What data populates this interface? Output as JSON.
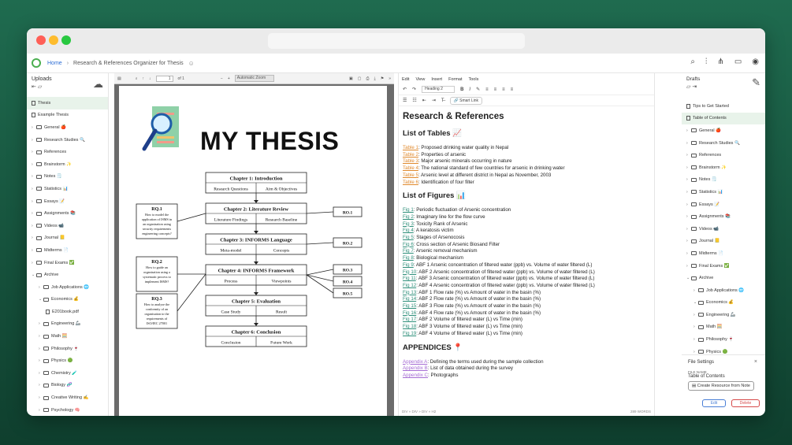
{
  "breadcrumb": {
    "home": "Home",
    "current": "Research & References Organizer for Thesis"
  },
  "left_panel": {
    "title": "Uploads",
    "items": [
      {
        "label": "Thesis",
        "type": "doc",
        "selected": true,
        "indent": 0
      },
      {
        "label": "Example Thesis",
        "type": "doc",
        "indent": 0
      },
      {
        "label": "General 🍎",
        "type": "folder",
        "indent": 0
      },
      {
        "label": "Research Studies 🔍",
        "type": "folder",
        "indent": 0
      },
      {
        "label": "References",
        "type": "folder",
        "indent": 0
      },
      {
        "label": "Brainstorm ✨",
        "type": "folder",
        "indent": 0
      },
      {
        "label": "Notes 🗒️",
        "type": "folder",
        "indent": 0
      },
      {
        "label": "Statistics 📊",
        "type": "folder",
        "indent": 0
      },
      {
        "label": "Essays 📝",
        "type": "folder",
        "indent": 0
      },
      {
        "label": "Assignments 📚",
        "type": "folder",
        "indent": 0
      },
      {
        "label": "Videos 📹",
        "type": "folder",
        "indent": 0
      },
      {
        "label": "Journal 📒",
        "type": "folder",
        "indent": 0
      },
      {
        "label": "Midterms 📄",
        "type": "folder",
        "indent": 0
      },
      {
        "label": "Final Exams ✅",
        "type": "folder",
        "indent": 0
      },
      {
        "label": "Archive",
        "type": "folder",
        "indent": 0
      },
      {
        "label": "Job Applications 🌐",
        "type": "folder",
        "indent": 1
      },
      {
        "label": "Economics 💰",
        "type": "folder",
        "indent": 1
      },
      {
        "label": "E201book.pdf",
        "type": "doc",
        "indent": 2
      },
      {
        "label": "Engineering 🦾",
        "type": "folder",
        "indent": 1
      },
      {
        "label": "Math 🧮",
        "type": "folder",
        "indent": 1
      },
      {
        "label": "Philosophy 🍷",
        "type": "folder",
        "indent": 1
      },
      {
        "label": "Physics 🟢",
        "type": "folder",
        "indent": 1
      },
      {
        "label": "Chemistry 🧪",
        "type": "folder",
        "indent": 1
      },
      {
        "label": "Biology 🧬",
        "type": "folder",
        "indent": 1
      },
      {
        "label": "Creative Writing ✍️",
        "type": "folder",
        "indent": 1
      },
      {
        "label": "Psychology 🧠",
        "type": "folder",
        "indent": 1
      }
    ]
  },
  "pdf": {
    "page_number": "1",
    "page_of": "of 1",
    "zoom": "Automatic Zoom",
    "title": "MY THESIS",
    "chapters": [
      {
        "title": "Chapter 1: Introduction",
        "left": "Research Questions",
        "right": "Aim & Objectives"
      },
      {
        "title": "Chapter 2: Literature Review",
        "left": "Literature Findings",
        "right": "Research Baseline"
      },
      {
        "title": "Chapter 3: INFORMS Language",
        "left": "Meta-model",
        "right": "Concepts"
      },
      {
        "title": "Chapter 4: INFORMS Framework",
        "left": "Process",
        "right": "Viewpoints"
      },
      {
        "title": "Chapter 5: Evaluation",
        "left": "Case Study",
        "right": "Result"
      },
      {
        "title": "Chapter 6: Conclusion",
        "left": "Conclusion",
        "right": "Future Work"
      }
    ],
    "rq": [
      {
        "title": "RQ.1",
        "text": "How to model the application of ISMS in an organisation using security requirements engineering concepts?"
      },
      {
        "title": "RQ.2",
        "text": "How to guide an organisation using a systematic process to implement ISMS?"
      },
      {
        "title": "RQ.3",
        "text": "How to analyse the conformity of an organisation to the requirements of ISO/IEC 27001 Standard?"
      }
    ],
    "ro": [
      "RO.1",
      "RO.2",
      "RO.3",
      "RO.4",
      "RO.5"
    ]
  },
  "editor": {
    "menu": [
      "Edit",
      "View",
      "Insert",
      "Format",
      "Tools"
    ],
    "heading_select": "Heading 2",
    "smart_link": "Smart Link",
    "doc_title": "Research & References",
    "tables_heading": "List of Tables 📈",
    "tables": [
      {
        "link": "Table 1",
        "text": ": Proposed drinking water quality in Nepal"
      },
      {
        "link": "Table 2",
        "text": ": Properties of arsenic"
      },
      {
        "link": "Table 3",
        "text": ": Major arsenic minerals occurring in nature"
      },
      {
        "link": "Table 4",
        "text": ": The national standard of few countries for arsenic in drinking water"
      },
      {
        "link": "Table 5",
        "text": ": Arsenic level at different district in Nepal as November, 2003"
      },
      {
        "link": "Table 6",
        "text": ": Identification of four filter"
      }
    ],
    "figures_heading": "List of Figures 📊",
    "figures": [
      {
        "link": "Fig 1",
        "text": ": Periodic fluctuation of Arsenic concentration"
      },
      {
        "link": "Fig 2",
        "text": ": Imaginary line for the flow curve"
      },
      {
        "link": "Fig 3",
        "text": ": Toxicity Rank of Arsenic"
      },
      {
        "link": "Fig 4",
        "text": ": A keratosis victim"
      },
      {
        "link": "Fig 5",
        "text": ": Stages of Arsenocosis"
      },
      {
        "link": "Fig 6",
        "text": ": Cross section of Arsenic Biosand Filter"
      },
      {
        "link": "Fig 7",
        "text": ": Arsenic removal mechanism"
      },
      {
        "link": "Fig 8",
        "text": ": Biological mechanism"
      },
      {
        "link": "Fig 9",
        "text": ": ABF 1 Arsenic concentration of filtered water (ppb) vs. Volume of water filtered (L)"
      },
      {
        "link": "Fig 10",
        "text": ": ABF 2 Arsenic concentration of filtered water (ppb) vs. Volume of water filtered (L)"
      },
      {
        "link": "Fig 11",
        "text": ": ABF 3 Arsenic concentration of filtered water (ppb) vs. Volume of water filtered (L)"
      },
      {
        "link": "Fig 12",
        "text": ": ABF 4 Arsenic concentration of filtered water (ppb) vs. Volume of water filtered (L)"
      },
      {
        "link": "Fig 13",
        "text": ": ABF 1 Flow rate (%) vs Amount of water in the basin (%)"
      },
      {
        "link": "Fig 14",
        "text": ": ABF 2 Flow rate (%) vs Amount of water in the basin (%)"
      },
      {
        "link": "Fig 15",
        "text": ": ABF 3 Flow rate (%) vs Amount of water in the basin (%)"
      },
      {
        "link": "Fig 16",
        "text": ": ABF 4 Flow rate (%) vs Amount of water in the basin (%)"
      },
      {
        "link": "Fig 17",
        "text": ": ABF 2 Volume of filtered water (L) vs Time (min)"
      },
      {
        "link": "Fig 18",
        "text": ": ABF 3 Volume of filtered water (L) vs Time (min)"
      },
      {
        "link": "Fig 19",
        "text": ": ABF 4 Volume of filtered water (L) vs Time (min)"
      }
    ],
    "appendices_heading": "APPENDICES 📍",
    "appendices": [
      {
        "link": "Appendix A",
        "text": ": Defining the terms used during the sample collection"
      },
      {
        "link": "Appendix B",
        "text": ": List of data obtained during the survey"
      },
      {
        "link": "Appendix C",
        "text": ": Photographs"
      }
    ],
    "footer_path": "DIV » DIV » DIV » H2",
    "word_count": "289 WORDS"
  },
  "right_panel": {
    "title": "Drafts",
    "items": [
      {
        "label": "Tips to Get Started",
        "type": "doc",
        "indent": 0
      },
      {
        "label": "Table of Contents",
        "type": "doc",
        "selected": true,
        "indent": 0
      },
      {
        "label": "General 🍎",
        "type": "folder",
        "indent": 0
      },
      {
        "label": "Research Studies 🔍",
        "type": "folder",
        "indent": 0
      },
      {
        "label": "References",
        "type": "folder",
        "indent": 0
      },
      {
        "label": "Brainstorm ✨",
        "type": "folder",
        "indent": 0
      },
      {
        "label": "Notes 🗒️",
        "type": "folder",
        "indent": 0
      },
      {
        "label": "Statistics 📊",
        "type": "folder",
        "indent": 0
      },
      {
        "label": "Essays 📝",
        "type": "folder",
        "indent": 0
      },
      {
        "label": "Assignments 📚",
        "type": "folder",
        "indent": 0
      },
      {
        "label": "Videos 📹",
        "type": "folder",
        "indent": 0
      },
      {
        "label": "Journal 📒",
        "type": "folder",
        "indent": 0
      },
      {
        "label": "Midterms 📄",
        "type": "folder",
        "indent": 0
      },
      {
        "label": "Final Exams ✅",
        "type": "folder",
        "indent": 0
      },
      {
        "label": "Archive",
        "type": "folder",
        "indent": 0
      },
      {
        "label": "Job Applications 🌐",
        "type": "folder",
        "indent": 1
      },
      {
        "label": "Economics 💰",
        "type": "folder",
        "indent": 1
      },
      {
        "label": "Engineering 🦾",
        "type": "folder",
        "indent": 1
      },
      {
        "label": "Math 🧮",
        "type": "folder",
        "indent": 1
      },
      {
        "label": "Philosophy 🍷",
        "type": "folder",
        "indent": 1
      },
      {
        "label": "Physics 🟢",
        "type": "folder",
        "indent": 1
      }
    ],
    "file_settings": {
      "title": "File Settings",
      "name_label": "FILE NAME",
      "name_value": "Table of Contents",
      "create_button": "Create Resource from Note",
      "edit_button": "Edit",
      "delete_button": "Delete"
    }
  },
  "colors": {
    "accent": "#2f6fd6",
    "background": "#1f6b4f",
    "selected_row": "#e8f3ea"
  }
}
